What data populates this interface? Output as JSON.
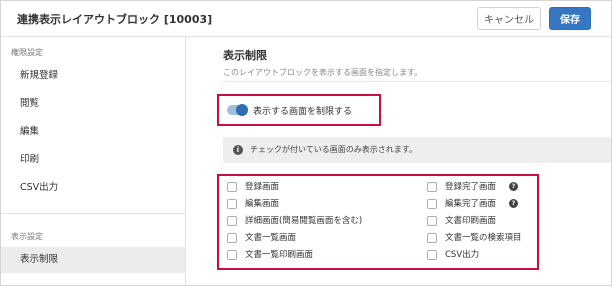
{
  "header": {
    "title": "連携表示レイアウトブロック [10003]",
    "cancel_label": "キャンセル",
    "save_label": "保存"
  },
  "sidebar": {
    "sections": [
      {
        "label": "権限設定",
        "items": [
          {
            "label": "新規登録"
          },
          {
            "label": "閲覧"
          },
          {
            "label": "編集"
          },
          {
            "label": "印刷"
          },
          {
            "label": "CSV出力"
          }
        ]
      },
      {
        "label": "表示設定",
        "items": [
          {
            "label": "表示制限",
            "active": true
          }
        ]
      }
    ]
  },
  "main": {
    "section_title": "表示制限",
    "section_description": "このレイアウトブロックを表示する画面を指定します。",
    "toggle": {
      "label": "表示する画面を制限する",
      "on": true
    },
    "info_message": "チェックが付いている画面のみ表示されます。",
    "left_checkboxes": [
      {
        "label": "登録画面",
        "checked": false
      },
      {
        "label": "編集画面",
        "checked": false
      },
      {
        "label": "詳細画面(簡易閲覧画面を含む)",
        "checked": false
      },
      {
        "label": "文書一覧画面",
        "checked": false
      },
      {
        "label": "文書一覧印刷画面",
        "checked": false
      }
    ],
    "right_checkboxes": [
      {
        "label": "登録完了画面",
        "checked": false,
        "help": true
      },
      {
        "label": "編集完了画面",
        "checked": false,
        "help": true
      },
      {
        "label": "文書印刷画面",
        "checked": false
      },
      {
        "label": "文書一覧の検索項目",
        "checked": false
      },
      {
        "label": "CSV出力",
        "checked": false
      }
    ]
  },
  "colors": {
    "primary": "#3577c3",
    "highlight": "#c8103e",
    "sidebar_active": "#ececec"
  }
}
